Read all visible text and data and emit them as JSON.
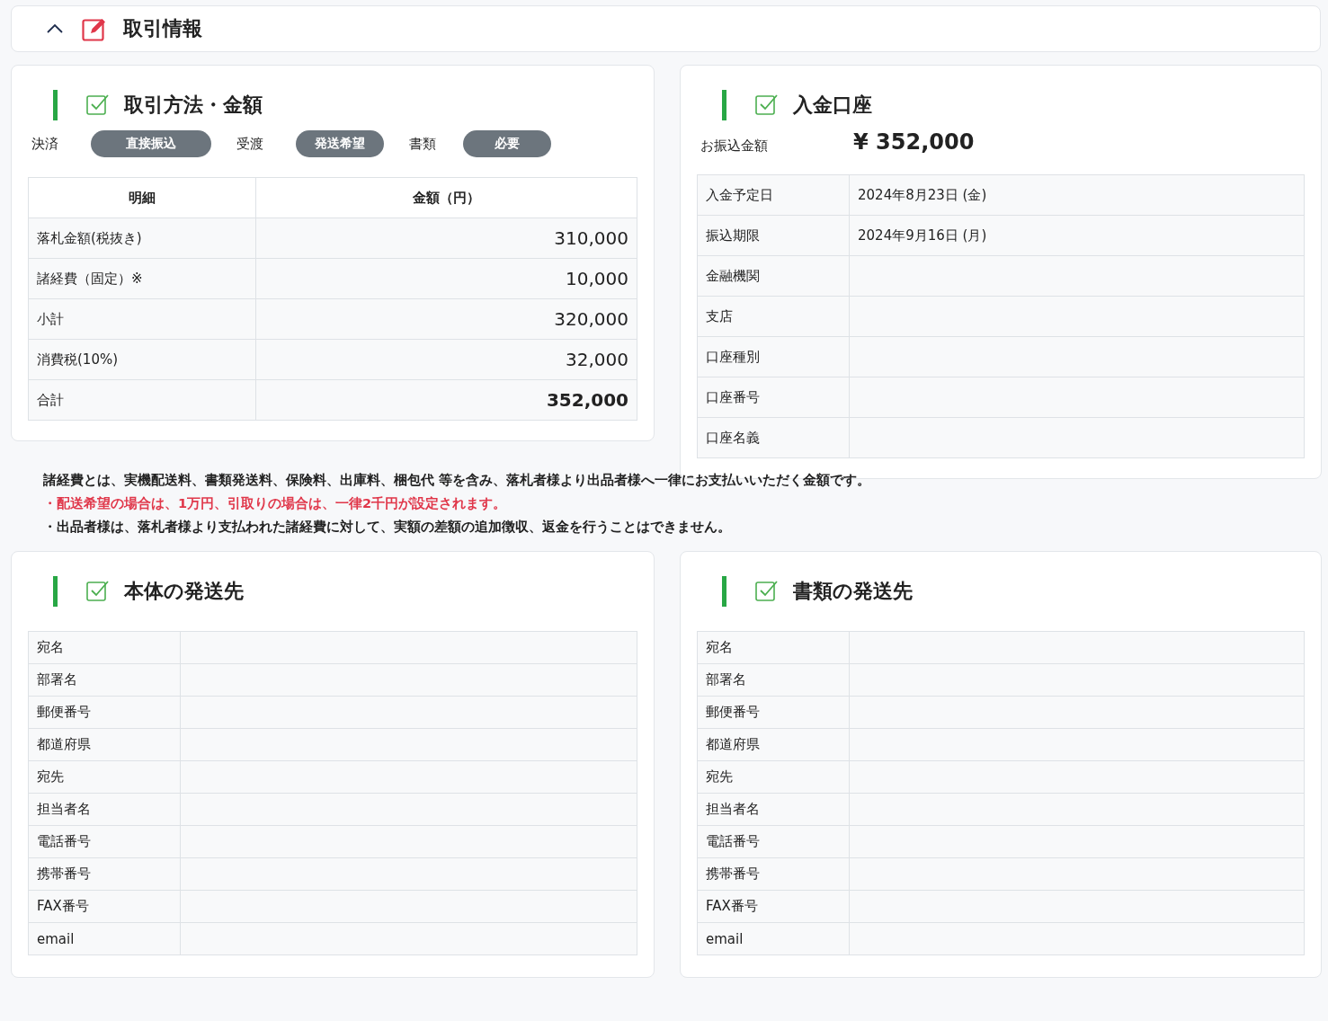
{
  "header": {
    "title": "取引情報"
  },
  "method": {
    "title": "取引方法・金額",
    "badges": [
      {
        "label": "決済",
        "value": "直接振込"
      },
      {
        "label": "受渡",
        "value": "発送希望"
      },
      {
        "label": "書類",
        "value": "必要"
      }
    ],
    "columns": [
      "明細",
      "金額（円）"
    ],
    "rows": [
      {
        "item": "落札金額(税抜き)",
        "amount": "310,000",
        "bold": false
      },
      {
        "item": "諸経費（固定）※",
        "amount": "10,000",
        "bold": false
      },
      {
        "item": "小計",
        "amount": "320,000",
        "bold": false
      },
      {
        "item": "消費税(10%)",
        "amount": "32,000",
        "bold": false
      },
      {
        "item": "合計",
        "amount": "352,000",
        "bold": true
      }
    ]
  },
  "account": {
    "title": "入金口座",
    "amount_label": "お振込金額",
    "amount": "¥ 352,000",
    "rows": [
      {
        "label": "入金予定日",
        "value": "2024年8月23日 (金)"
      },
      {
        "label": "振込期限",
        "value": "2024年9月16日 (月)"
      },
      {
        "label": "金融機関"
      },
      {
        "label": "支店"
      },
      {
        "label": "口座種別"
      },
      {
        "label": "口座番号"
      },
      {
        "label": "口座名義"
      }
    ]
  },
  "notes": [
    {
      "kind": "normal",
      "text": "諸経費とは、実機配送料、書類発送料、保険料、出庫料、梱包代 等を含み、落札者様より出品者様へ一律にお支払いいただく金額です。"
    },
    {
      "kind": "warning",
      "text": "・配送希望の場合は、1万円、引取りの場合は、一律2千円が設定されます。"
    },
    {
      "kind": "normal",
      "text": "・出品者様は、落札者様より支払われた諸経費に対して、実額の差額の追加徴収、返金を行うことはできません。"
    }
  ],
  "shipping": [
    {
      "title": "本体の発送先",
      "rows": [
        "宛名",
        "部署名",
        "郵便番号",
        "都道府県",
        "宛先",
        "担当者名",
        "電話番号",
        "携帯番号",
        "FAX番号",
        "email"
      ]
    },
    {
      "title": "書類の発送先",
      "rows": [
        "宛名",
        "部署名",
        "郵便番号",
        "都道府県",
        "宛先",
        "担当者名",
        "電話番号",
        "携帯番号",
        "FAX番号",
        "email"
      ]
    }
  ]
}
